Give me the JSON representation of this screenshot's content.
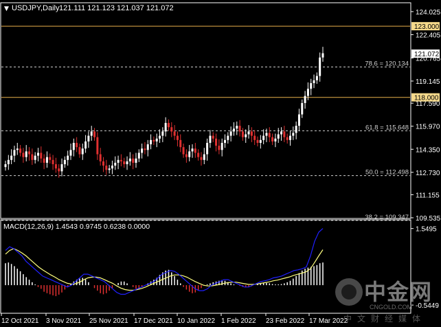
{
  "header": {
    "symbol": "USDJPY,Daily",
    "ohlc": "121.111 121.123 121.037 121.072"
  },
  "price_axis": {
    "ticks": [
      "124.025",
      "122.405",
      "120.765",
      "119.145",
      "117.590",
      "115.970",
      "114.350",
      "112.730",
      "111.155",
      "109.535"
    ],
    "badges": [
      {
        "text": "123.000",
        "bg": "#f5d98b",
        "fg": "#000000"
      },
      {
        "text": "121.072",
        "bg": "#ffffff",
        "fg": "#000000"
      },
      {
        "text": "118.000",
        "bg": "#f5d98b",
        "fg": "#000000"
      }
    ]
  },
  "levels": {
    "resistance_1": 123.0,
    "resistance_2": 118.0,
    "color": "#e8b04a"
  },
  "fib": [
    {
      "label": "78.6 = 120.134",
      "value": 120.134
    },
    {
      "label": "61.8 = 115.648",
      "value": 115.648
    },
    {
      "label": "50.0 = 112.498",
      "value": 112.498
    },
    {
      "label": "38.2 = 109.347",
      "value": 109.347
    }
  ],
  "macd": {
    "label": "MACD(12,26,9) 1.4543 0.9745 0.6238 0.0000",
    "ticks": [
      "1.5495",
      "-0.5449"
    ],
    "ylim": [
      -0.75,
      1.75
    ]
  },
  "time_axis": [
    "12 Oct 2021",
    "3 Nov 2021",
    "25 Nov 2021",
    "17 Dec 2021",
    "10 Jan 2022",
    "1 Feb 2022",
    "23 Feb 2022",
    "17 Mar 2022"
  ],
  "watermark": {
    "cn": "中金网",
    "en": "CNGOLD.COM",
    "tag": "中文财经媒体"
  },
  "colors": {
    "up": "#ffffff",
    "down": "#e03030",
    "grid": "#ffffff",
    "macd_line": "#2020ff",
    "signal_line": "#ffff80"
  },
  "chart_data": {
    "type": "candlestick",
    "symbol": "USDJPY",
    "timeframe": "Daily",
    "ylim": [
      109.535,
      124.6
    ],
    "closes": [
      113.3,
      113.6,
      113.9,
      114.3,
      114.4,
      114.1,
      113.8,
      114.2,
      114.0,
      113.6,
      113.9,
      114.1,
      113.7,
      113.4,
      113.8,
      113.6,
      113.3,
      113.0,
      112.8,
      113.3,
      113.6,
      113.9,
      114.3,
      114.8,
      114.5,
      114.0,
      114.4,
      114.9,
      115.3,
      115.6,
      115.2,
      114.0,
      113.5,
      113.2,
      112.9,
      113.0,
      113.2,
      113.4,
      113.6,
      113.5,
      113.3,
      113.5,
      113.7,
      113.4,
      113.7,
      114.1,
      114.4,
      114.3,
      114.7,
      115.0,
      114.9,
      115.1,
      115.3,
      115.6,
      116.2,
      115.9,
      115.6,
      115.3,
      115.0,
      114.5,
      114.0,
      113.8,
      114.2,
      114.4,
      114.1,
      113.8,
      113.6,
      114.0,
      114.8,
      115.3,
      115.1,
      114.6,
      114.3,
      114.8,
      115.0,
      115.3,
      115.6,
      115.8,
      116.0,
      115.6,
      115.2,
      115.4,
      115.6,
      115.3,
      115.0,
      114.8,
      115.0,
      115.3,
      115.5,
      115.2,
      114.9,
      115.1,
      115.4,
      115.6,
      115.2,
      115.0,
      115.3,
      115.5,
      116.0,
      116.8,
      117.6,
      118.1,
      118.6,
      119.0,
      119.2,
      119.5,
      120.8,
      121.1
    ],
    "macd": [
      0.95,
      1.05,
      1.0,
      0.9,
      0.8,
      0.65,
      0.55,
      0.45,
      0.35,
      0.25,
      0.2,
      0.15,
      0.1,
      0.05,
      0.0,
      -0.05,
      0.0,
      0.1,
      0.2,
      0.3,
      0.3,
      0.25,
      0.2,
      0.15,
      0.1,
      0.0,
      -0.1,
      -0.2,
      -0.25,
      -0.25,
      -0.2,
      -0.15,
      -0.1,
      -0.05,
      0.0,
      0.05,
      0.1,
      0.2,
      0.3,
      0.35,
      0.4,
      0.38,
      0.3,
      0.2,
      0.1,
      0.0,
      -0.1,
      -0.15,
      -0.15,
      -0.1,
      0.0,
      0.05,
      0.1,
      0.15,
      0.15,
      0.1,
      0.05,
      0.0,
      -0.05,
      -0.05,
      0.0,
      0.05,
      0.1,
      0.12,
      0.15,
      0.2,
      0.22,
      0.25,
      0.3,
      0.35,
      0.4,
      0.42,
      0.45,
      0.5,
      0.8,
      1.2,
      1.45,
      1.55
    ],
    "signal": [
      0.85,
      0.95,
      1.0,
      0.95,
      0.88,
      0.8,
      0.7,
      0.6,
      0.5,
      0.42,
      0.35,
      0.28,
      0.22,
      0.15,
      0.1,
      0.05,
      0.03,
      0.04,
      0.08,
      0.15,
      0.2,
      0.22,
      0.22,
      0.2,
      0.15,
      0.1,
      0.05,
      -0.02,
      -0.08,
      -0.12,
      -0.14,
      -0.14,
      -0.12,
      -0.09,
      -0.05,
      0.0,
      0.05,
      0.1,
      0.15,
      0.2,
      0.25,
      0.28,
      0.28,
      0.26,
      0.22,
      0.16,
      0.1,
      0.05,
      0.0,
      -0.02,
      -0.02,
      0.0,
      0.02,
      0.05,
      0.07,
      0.08,
      0.08,
      0.06,
      0.04,
      0.02,
      0.02,
      0.03,
      0.05,
      0.07,
      0.09,
      0.12,
      0.14,
      0.17,
      0.2,
      0.23,
      0.27,
      0.3,
      0.33,
      0.37,
      0.45,
      0.62,
      0.8,
      0.97
    ],
    "hist": [
      0.6,
      0.62,
      0.58,
      0.52,
      0.45,
      0.38,
      0.3,
      0.22,
      0.15,
      0.08,
      0.02,
      -0.05,
      -0.1,
      -0.18,
      -0.22,
      -0.25,
      -0.28,
      -0.3,
      -0.26,
      -0.2,
      -0.12,
      -0.05,
      0.03,
      0.1,
      0.15,
      0.18,
      0.2,
      0.16,
      0.08,
      0.0,
      -0.08,
      -0.15,
      -0.22,
      -0.25,
      -0.22,
      -0.15,
      -0.08,
      0.0,
      0.06,
      0.1,
      0.1,
      0.05,
      0.0,
      -0.05,
      -0.1,
      -0.1,
      -0.05,
      0.0,
      0.05,
      0.1,
      0.15,
      0.2,
      0.28,
      0.35,
      0.4,
      0.42,
      0.35,
      0.25,
      0.15,
      0.05,
      -0.05,
      -0.12,
      -0.18,
      -0.22,
      -0.2,
      -0.15,
      -0.08,
      -0.02,
      0.02,
      0.05,
      0.08,
      0.1,
      0.12,
      0.14,
      0.12,
      0.08,
      0.05,
      0.02,
      0.0,
      -0.02,
      -0.05,
      -0.06,
      -0.05,
      -0.03,
      0.0,
      0.03,
      0.05,
      0.06,
      0.06,
      0.05,
      0.03,
      0.02,
      0.02,
      0.03,
      0.05,
      0.08,
      0.12,
      0.18,
      0.25,
      0.33,
      0.4,
      0.45,
      0.48,
      0.5,
      0.52,
      0.55,
      0.6,
      0.62
    ]
  }
}
